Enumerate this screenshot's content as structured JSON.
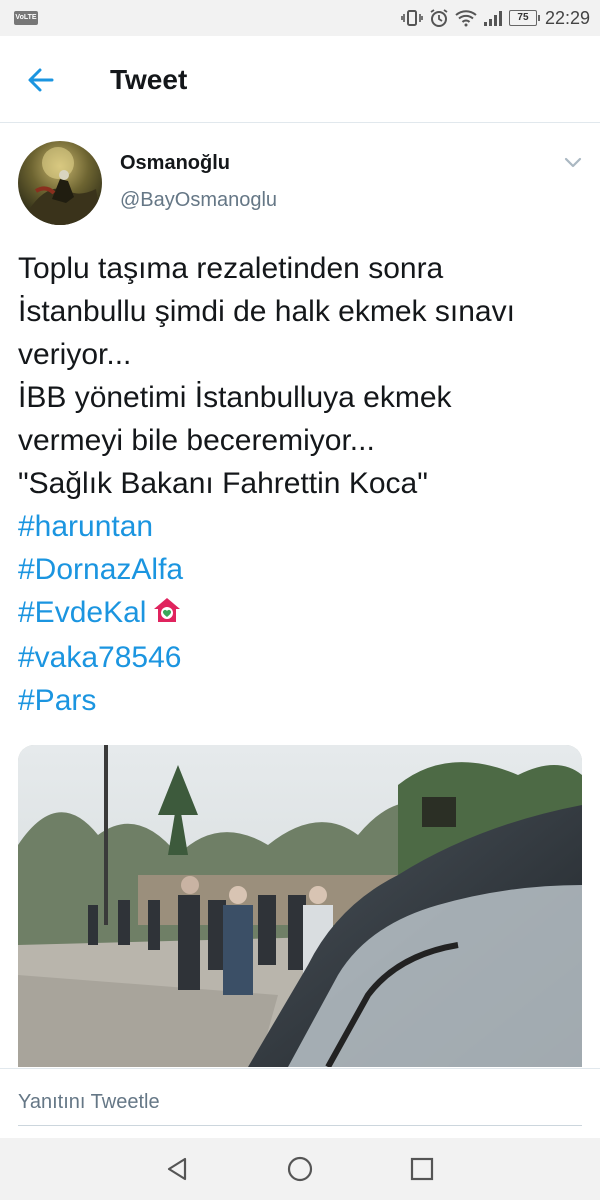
{
  "status_bar": {
    "network_badge": "VoLTE",
    "battery_level": "75",
    "time": "22:29"
  },
  "header": {
    "title": "Tweet"
  },
  "author": {
    "name": "Osmanoğlu",
    "handle": "@BayOsmanoglu"
  },
  "tweet": {
    "lines": [
      "Toplu taşıma rezaletinden sonra",
      "İstanbullu şimdi de halk ekmek sınavı",
      "veriyor...",
      "İBB yönetimi İstanbulluya ekmek",
      "vermeyi bile beceremiyor...",
      "\"Sağlık Bakanı Fahrettin Koca\""
    ],
    "hashtags": [
      "#haruntan",
      "#DornazAlfa",
      "#EvdeKal",
      "#vaka78546",
      "#Pars"
    ]
  },
  "reply": {
    "placeholder": "Yanıtını Tweetle"
  },
  "colors": {
    "link": "#1b95e0",
    "text": "#14171a",
    "secondary": "#657786",
    "divider": "#e1e8ed"
  },
  "icons": {
    "back": "arrow-left-icon",
    "caret": "chevron-down-icon",
    "emoji": "house-with-heart-icon",
    "nav_back": "triangle-back-icon",
    "nav_home": "circle-home-icon",
    "nav_recents": "square-recents-icon"
  }
}
